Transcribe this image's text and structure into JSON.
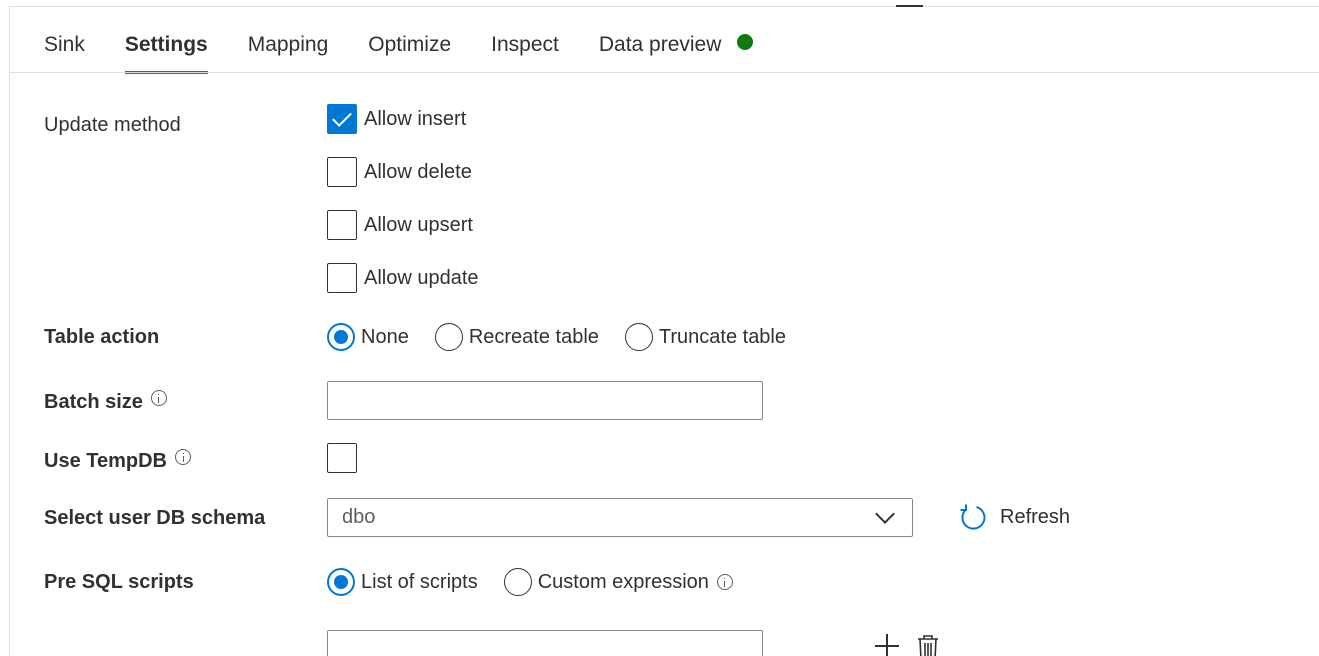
{
  "tabs": [
    {
      "label": "Sink"
    },
    {
      "label": "Settings"
    },
    {
      "label": "Mapping"
    },
    {
      "label": "Optimize"
    },
    {
      "label": "Inspect"
    },
    {
      "label": "Data preview"
    }
  ],
  "active_tab": "Settings",
  "data_preview_status_color": "#107c10",
  "update_method": {
    "label": "Update method",
    "options": [
      {
        "label": "Allow insert",
        "checked": true
      },
      {
        "label": "Allow delete",
        "checked": false
      },
      {
        "label": "Allow upsert",
        "checked": false
      },
      {
        "label": "Allow update",
        "checked": false
      }
    ]
  },
  "table_action": {
    "label": "Table action",
    "options": [
      "None",
      "Recreate table",
      "Truncate table"
    ],
    "selected": "None"
  },
  "batch_size": {
    "label": "Batch size",
    "value": ""
  },
  "use_tempdb": {
    "label": "Use TempDB",
    "checked": false
  },
  "db_schema": {
    "label": "Select user DB schema",
    "value": "dbo",
    "refresh_label": "Refresh"
  },
  "pre_sql": {
    "label": "Pre SQL scripts",
    "options": [
      "List of scripts",
      "Custom expression"
    ],
    "selected": "List of scripts",
    "script_value": ""
  },
  "colors": {
    "accent": "#0078d4",
    "status_green": "#107c10",
    "text": "#323130",
    "border": "#8a8886"
  }
}
